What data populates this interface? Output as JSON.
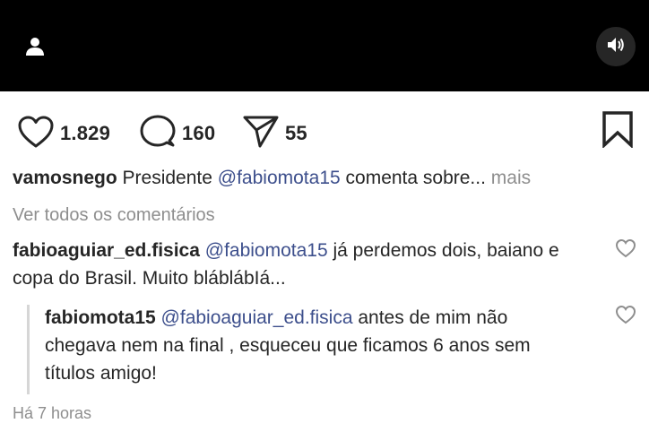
{
  "post": {
    "likes": "1.829",
    "comments": "160",
    "shares": "55"
  },
  "caption": {
    "username": "vamosnego",
    "text_before": " Presidente ",
    "mention": "@fabiomota15",
    "text_after": " comenta sobre...",
    "more_label": " mais"
  },
  "view_all_comments": "Ver todos os comentários",
  "comments": [
    {
      "username": "fabioaguiar_ed.fisica",
      "mention": "@fabiomota15",
      "text": " já perdemos dois, baiano e copa do Brasil. Muito bláblábIá..."
    },
    {
      "username": "fabiomota15",
      "mention": "@fabioaguiar_ed.fisica",
      "text": " antes de mim não chegava nem na final , esqueceu que ficamos 6 anos sem títulos amigo!"
    }
  ],
  "timestamp": "Há 7 horas",
  "icons": {
    "user_tag": "person-icon",
    "mute": "speaker-icon",
    "like": "heart-icon",
    "comment": "speech-bubble-icon",
    "share": "paper-plane-icon",
    "save": "bookmark-icon"
  }
}
